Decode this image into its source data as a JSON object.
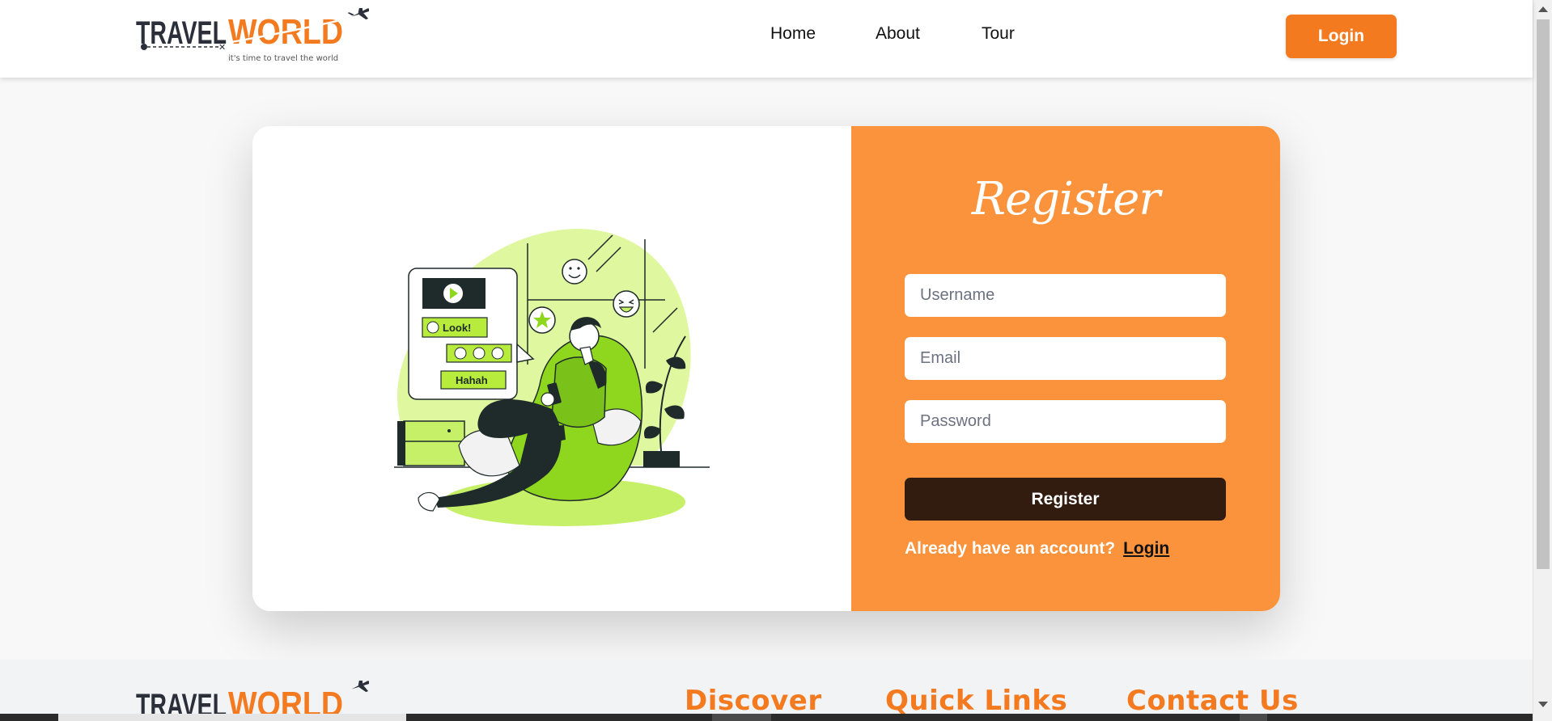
{
  "brand": {
    "name_part1": "TRAVEL",
    "name_part2": "WORLD",
    "tagline": "it's time to travel the world",
    "dark_color": "#2b2f3a",
    "accent_color": "#f47a20",
    "icon": "airplane-icon"
  },
  "nav": {
    "items": [
      {
        "label": "Home"
      },
      {
        "label": "About"
      },
      {
        "label": "Tour"
      }
    ],
    "login_label": "Login"
  },
  "illustration": {
    "bubble_look": "Look!",
    "bubble_haha": "Hahah",
    "accent_color": "#c6f067"
  },
  "register": {
    "title": "Register",
    "username_placeholder": "Username",
    "email_placeholder": "Email",
    "password_placeholder": "Password",
    "submit_label": "Register",
    "already_text": "Already have an account?",
    "login_link": "Login",
    "panel_color": "#fb923c",
    "button_color": "#321c0f"
  },
  "footer": {
    "headings": [
      "Discover",
      "Quick Links",
      "Contact Us"
    ],
    "heading_color": "#f47a20"
  }
}
